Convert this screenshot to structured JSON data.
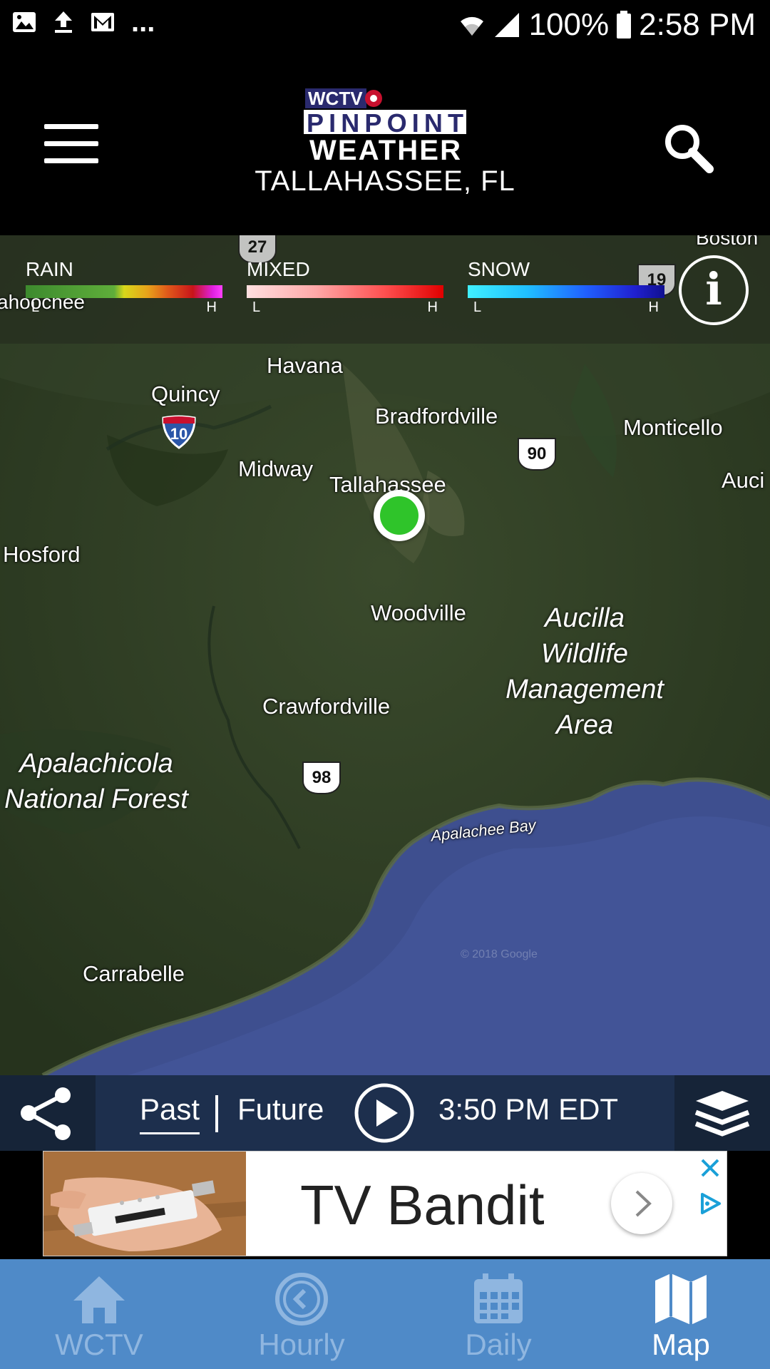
{
  "status_bar": {
    "battery": "100%",
    "time": "2:58 PM",
    "overflow": "..."
  },
  "header": {
    "logo_text_top": "WCTV",
    "logo_text_mid": "PINPOINT",
    "logo_text_bottom": "WEATHER",
    "location": "TALLAHASSEE, FL"
  },
  "legend": {
    "rain": {
      "title": "RAIN",
      "low": "L",
      "high": "H"
    },
    "mixed": {
      "title": "MIXED",
      "low": "L",
      "high": "H"
    },
    "snow": {
      "title": "SNOW",
      "low": "L",
      "high": "H"
    },
    "info_label": "i"
  },
  "map": {
    "places": {
      "havana": "Havana",
      "quincy": "Quincy",
      "bradfordville": "Bradfordville",
      "monticello": "Monticello",
      "midway": "Midway",
      "tallahassee": "Tallahassee",
      "auci": "Auci",
      "hosford": "Hosford",
      "woodville": "Woodville",
      "crawfordville": "Crawfordville",
      "carrabelle": "Carrabelle",
      "boston": "Boston",
      "ahoochee": "ahoochee",
      "apalachee_bay": "Apalachee Bay"
    },
    "regions": {
      "aucilla": [
        "Aucilla",
        "Wildlife",
        "Management",
        "Area"
      ],
      "apalachicola": [
        "Apalachicola",
        "National Forest"
      ]
    },
    "routes": {
      "us27": "27",
      "us19": "19",
      "i10": "10",
      "us90": "90",
      "us98": "98"
    },
    "attribution": "© 2018 Google"
  },
  "playback": {
    "past_label": "Past",
    "future_label": "Future",
    "time": "3:50 PM EDT"
  },
  "ad": {
    "title": "TV Bandit"
  },
  "bottom_nav": {
    "items": [
      {
        "label": "WCTV",
        "icon": "home-icon"
      },
      {
        "label": "Hourly",
        "icon": "clock-icon"
      },
      {
        "label": "Daily",
        "icon": "calendar-icon"
      },
      {
        "label": "Map",
        "icon": "map-icon"
      }
    ],
    "active": "Map"
  },
  "colors": {
    "nav_bg": "#4f8ac8",
    "playbar_bg": "#1d2f4d",
    "location_dot": "#2fc42a",
    "water": "#3e4f8f"
  }
}
